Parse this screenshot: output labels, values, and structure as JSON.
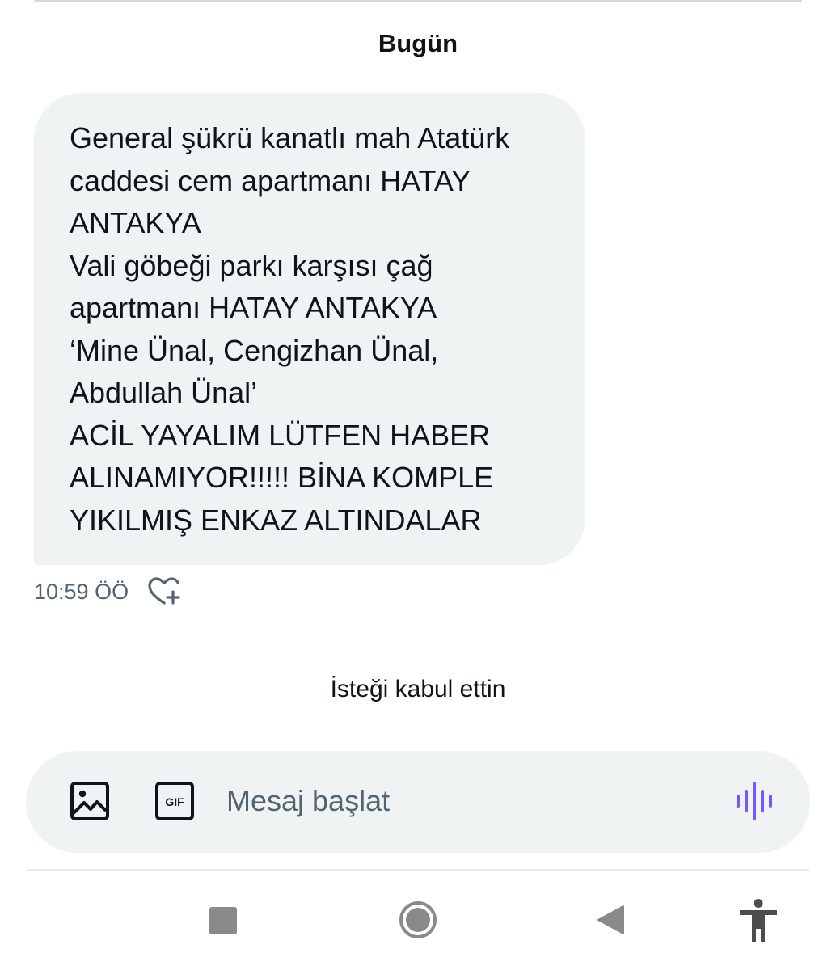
{
  "conversation": {
    "date_header": "Bugün",
    "message": {
      "lines": [
        "General şükrü kanatlı mah Atatürk",
        "caddesi cem apartmanı HATAY",
        "ANTAKYA",
        "Vali göbeği parkı karşısı çağ",
        "apartmanı HATAY ANTAKYA",
        "‘Mine Ünal, Cengizhan Ünal,",
        "Abdullah Ünal’",
        "ACİL YAYALIM LÜTFEN HABER",
        "ALINAMIYOR!!!!! BİNA KOMPLE",
        "YIKILMIŞ ENKAZ ALTINDALAR"
      ],
      "timestamp": "10:59 ÖÖ",
      "reaction_icon": "heart-plus-icon"
    },
    "system_message": "İsteği kabul ettin"
  },
  "composer": {
    "placeholder": "Mesaj başlat",
    "media_icon": "image-icon",
    "gif_icon": "gif-icon",
    "voice_icon": "voice-waveform-icon",
    "voice_color": "#7856ff"
  },
  "navbar": {
    "recents_icon": "square-recents-icon",
    "home_icon": "circle-home-icon",
    "back_icon": "triangle-back-icon",
    "accessibility_icon": "accessibility-person-icon"
  }
}
